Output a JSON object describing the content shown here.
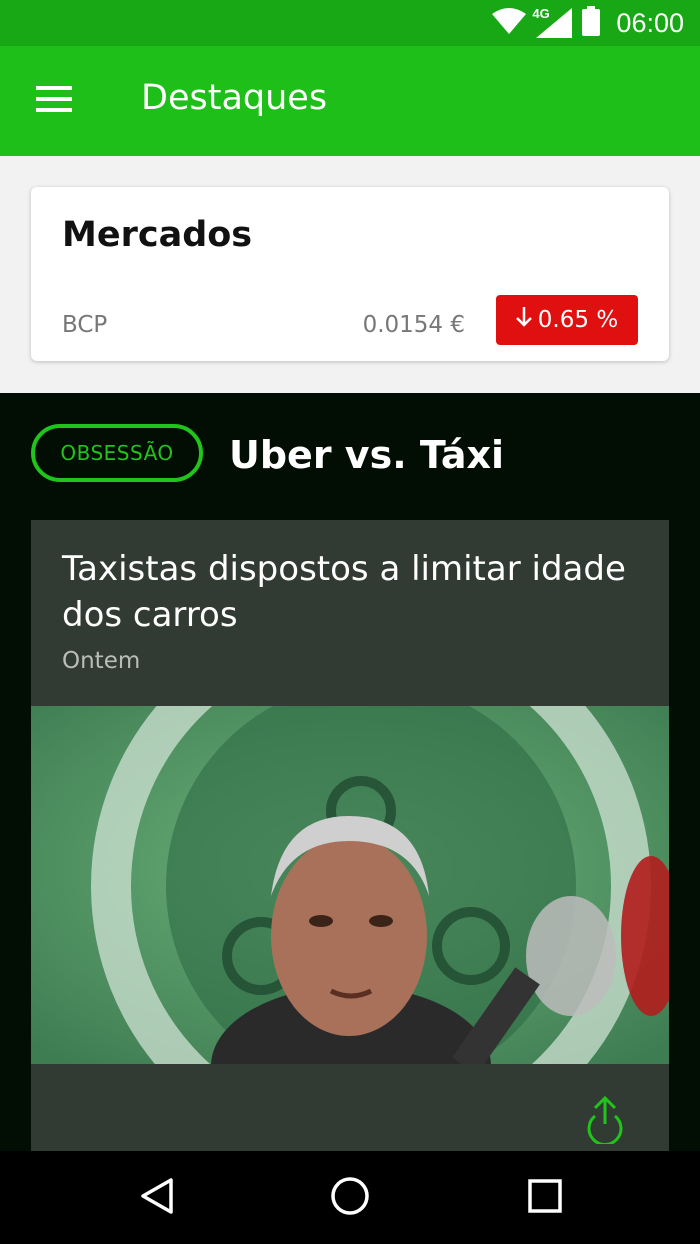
{
  "status_bar": {
    "time": "06:00",
    "network": "4G",
    "icons": [
      "wifi-icon",
      "cellular-signal-icon",
      "battery-icon"
    ]
  },
  "app_bar": {
    "title": "Destaques",
    "menu_icon": "hamburger-menu-icon"
  },
  "markets": {
    "title": "Mercados",
    "items": [
      {
        "ticker": "BCP",
        "price": "0.0154 €",
        "change": "0.65 %",
        "direction": "down",
        "change_color": "#e01010"
      }
    ]
  },
  "topic": {
    "badge": "OBSESSÃO",
    "title": "Uber vs. Táxi"
  },
  "article": {
    "title": "Taxistas dispostos a limitar idade dos carros",
    "date": "Ontem",
    "image": "man-speaking-at-press-conference-photo",
    "share_icon": "share-icon"
  },
  "nav_bar": {
    "buttons": [
      "back-icon",
      "home-icon",
      "recents-icon"
    ]
  },
  "colors": {
    "status_bar": "#18a815",
    "app_bar": "#1dbf18",
    "accent": "#21c41b",
    "negative": "#e01010",
    "dark_bg": "#020d04",
    "card_dark": "#323a34"
  }
}
